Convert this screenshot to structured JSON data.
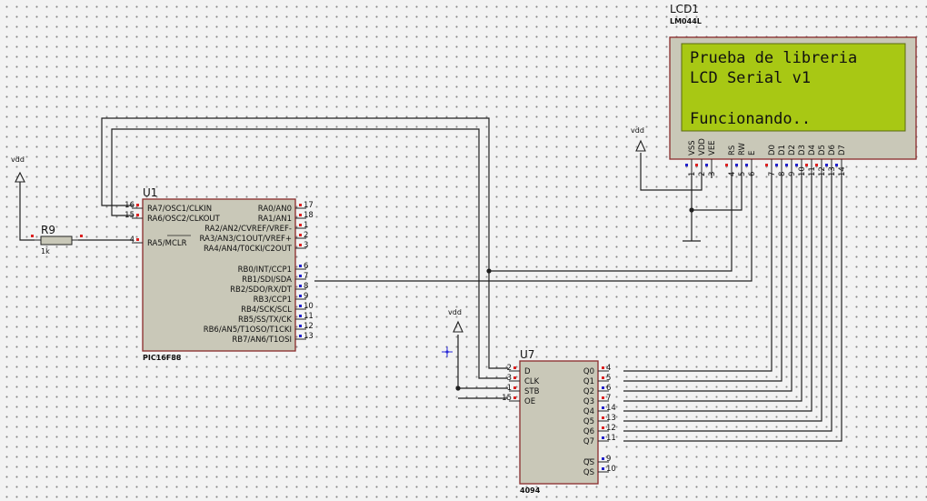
{
  "lcd": {
    "ref": "LCD1",
    "part": "LM044L",
    "lines": [
      "Prueba de libreria",
      "LCD Serial v1",
      "",
      "Funcionando.."
    ],
    "pins": [
      {
        "name": "VSS",
        "num": "1"
      },
      {
        "name": "VDD",
        "num": "2"
      },
      {
        "name": "VEE",
        "num": "3"
      },
      {
        "name": "RS",
        "num": "4"
      },
      {
        "name": "RW",
        "num": "5"
      },
      {
        "name": "E",
        "num": "6"
      },
      {
        "name": "D0",
        "num": "7"
      },
      {
        "name": "D1",
        "num": "8"
      },
      {
        "name": "D2",
        "num": "9"
      },
      {
        "name": "D3",
        "num": "10"
      },
      {
        "name": "D4",
        "num": "11"
      },
      {
        "name": "D5",
        "num": "12"
      },
      {
        "name": "D6",
        "num": "13"
      },
      {
        "name": "D7",
        "num": "14"
      }
    ]
  },
  "u1": {
    "ref": "U1",
    "part": "PIC16F88",
    "left_pins": [
      {
        "name": "RA7/OSC1/CLKIN",
        "num": "16"
      },
      {
        "name": "RA6/OSC2/CLKOUT",
        "num": "15"
      },
      {
        "name": "RA5/MCLR",
        "num": "4"
      }
    ],
    "right_pins": [
      {
        "name": "RA0/AN0",
        "num": "17"
      },
      {
        "name": "RA1/AN1",
        "num": "18"
      },
      {
        "name": "RA2/AN2/CVREF/VREF-",
        "num": "1"
      },
      {
        "name": "RA3/AN3/C1OUT/VREF+",
        "num": "2"
      },
      {
        "name": "RA4/AN4/T0CKI/C2OUT",
        "num": "3"
      },
      {
        "name": "RB0/INT/CCP1",
        "num": "6"
      },
      {
        "name": "RB1/SDI/SDA",
        "num": "7"
      },
      {
        "name": "RB2/SDO/RX/DT",
        "num": "8"
      },
      {
        "name": "RB3/CCP1",
        "num": "9"
      },
      {
        "name": "RB4/SCK/SCL",
        "num": "10"
      },
      {
        "name": "RB5/SS/TX/CK",
        "num": "11"
      },
      {
        "name": "RB6/AN5/T1OSO/T1CKI",
        "num": "12"
      },
      {
        "name": "RB7/AN6/T1OSI",
        "num": "13"
      }
    ]
  },
  "u7": {
    "ref": "U7",
    "part": "4094",
    "left_pins": [
      {
        "name": "D",
        "num": "2"
      },
      {
        "name": "CLK",
        "num": "3"
      },
      {
        "name": "STB",
        "num": "1"
      },
      {
        "name": "OE",
        "num": "15"
      }
    ],
    "right_pins": [
      {
        "name": "Q0",
        "num": "4"
      },
      {
        "name": "Q1",
        "num": "5"
      },
      {
        "name": "Q2",
        "num": "6"
      },
      {
        "name": "Q3",
        "num": "7"
      },
      {
        "name": "Q4",
        "num": "14"
      },
      {
        "name": "Q5",
        "num": "13"
      },
      {
        "name": "Q6",
        "num": "12"
      },
      {
        "name": "Q7",
        "num": "11"
      },
      {
        "name": "QS",
        "num": "9"
      },
      {
        "name": "QS",
        "num": "10"
      }
    ]
  },
  "r9": {
    "ref": "R9",
    "value": "1k"
  },
  "power": {
    "label": "vdd"
  }
}
